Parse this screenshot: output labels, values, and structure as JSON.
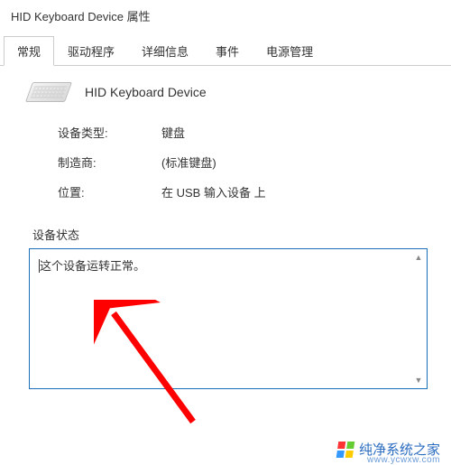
{
  "window": {
    "title": "HID Keyboard Device 属性"
  },
  "tabs": [
    {
      "label": "常规",
      "active": true
    },
    {
      "label": "驱动程序",
      "active": false
    },
    {
      "label": "详细信息",
      "active": false
    },
    {
      "label": "事件",
      "active": false
    },
    {
      "label": "电源管理",
      "active": false
    }
  ],
  "device": {
    "name": "HID Keyboard Device",
    "icon": "keyboard-icon"
  },
  "info": {
    "type_label": "设备类型:",
    "type_value": "键盘",
    "mfr_label": "制造商:",
    "mfr_value": "(标准键盘)",
    "loc_label": "位置:",
    "loc_value": "在 USB 输入设备 上"
  },
  "status": {
    "section_label": "设备状态",
    "text": "这个设备运转正常。"
  },
  "watermark": {
    "text": "纯净系统之家",
    "sub": "www.ycwxw.com"
  },
  "annotation": {
    "type": "red-arrow"
  }
}
